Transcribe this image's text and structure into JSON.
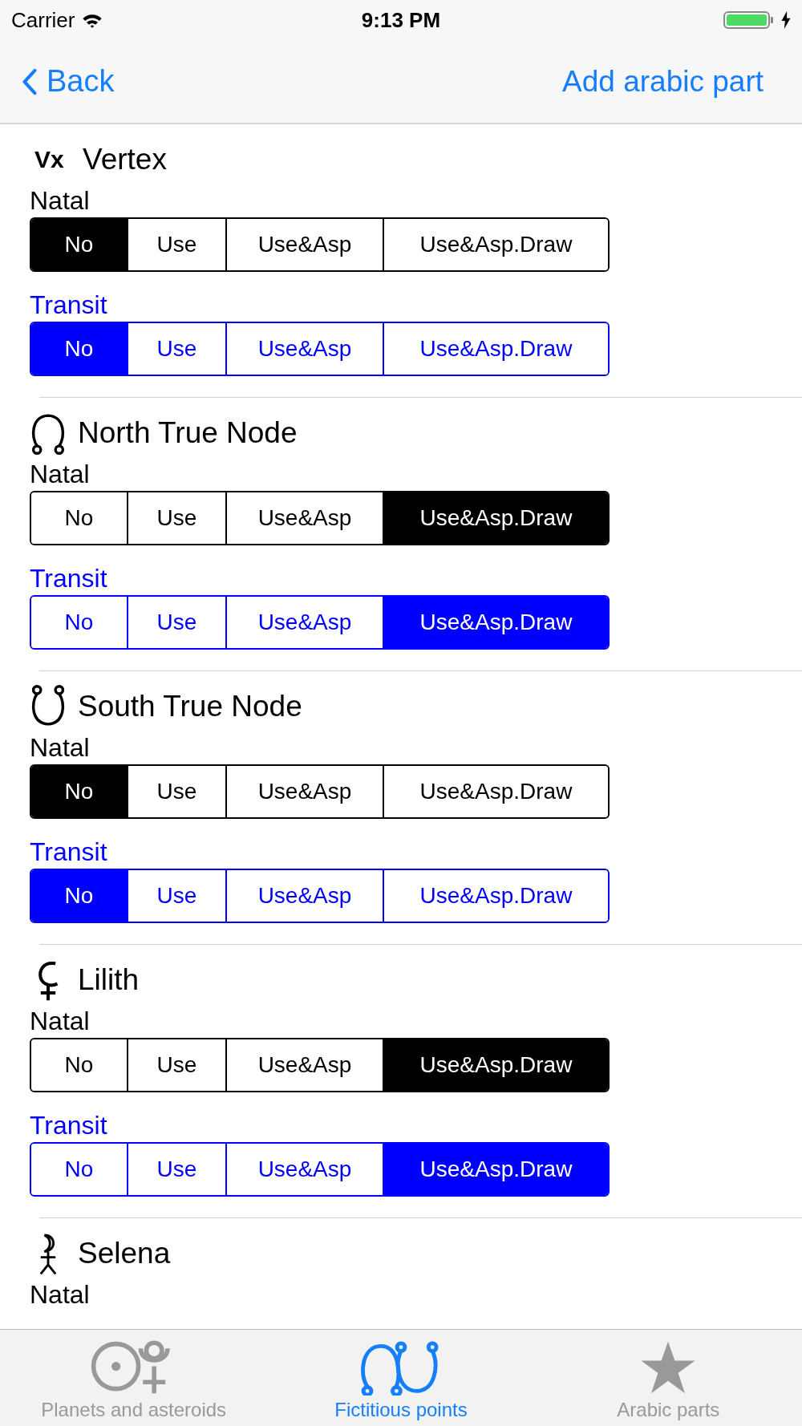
{
  "status_bar": {
    "carrier": "Carrier",
    "time": "9:13 PM"
  },
  "nav": {
    "back": "Back",
    "action": "Add arabic part"
  },
  "points": [
    {
      "name": "Vertex",
      "symbol": {
        "kind": "text",
        "text": "Vx"
      },
      "rows": [
        {
          "label": "Natal",
          "kind": "natal",
          "options": [
            {
              "label": "No",
              "selected": true
            },
            {
              "label": "Use",
              "selected": false
            },
            {
              "label": "Use&Asp",
              "selected": false
            },
            {
              "label": "Use&Asp.Draw",
              "selected": false
            }
          ]
        },
        {
          "label": "Transit",
          "kind": "transit",
          "options": [
            {
              "label": "No",
              "selected": true
            },
            {
              "label": "Use",
              "selected": false
            },
            {
              "label": "Use&Asp",
              "selected": false
            },
            {
              "label": "Use&Asp.Draw",
              "selected": false
            }
          ]
        }
      ]
    },
    {
      "name": "North True Node",
      "symbol": {
        "kind": "north-node"
      },
      "rows": [
        {
          "label": "Natal",
          "kind": "natal",
          "options": [
            {
              "label": "No",
              "selected": false
            },
            {
              "label": "Use",
              "selected": false
            },
            {
              "label": "Use&Asp",
              "selected": false
            },
            {
              "label": "Use&Asp.Draw",
              "selected": true
            }
          ]
        },
        {
          "label": "Transit",
          "kind": "transit",
          "options": [
            {
              "label": "No",
              "selected": false
            },
            {
              "label": "Use",
              "selected": false
            },
            {
              "label": "Use&Asp",
              "selected": false
            },
            {
              "label": "Use&Asp.Draw",
              "selected": true
            }
          ]
        }
      ]
    },
    {
      "name": "South True Node",
      "symbol": {
        "kind": "south-node"
      },
      "rows": [
        {
          "label": "Natal",
          "kind": "natal",
          "options": [
            {
              "label": "No",
              "selected": true
            },
            {
              "label": "Use",
              "selected": false
            },
            {
              "label": "Use&Asp",
              "selected": false
            },
            {
              "label": "Use&Asp.Draw",
              "selected": false
            }
          ]
        },
        {
          "label": "Transit",
          "kind": "transit",
          "options": [
            {
              "label": "No",
              "selected": true
            },
            {
              "label": "Use",
              "selected": false
            },
            {
              "label": "Use&Asp",
              "selected": false
            },
            {
              "label": "Use&Asp.Draw",
              "selected": false
            }
          ]
        }
      ]
    },
    {
      "name": "Lilith",
      "symbol": {
        "kind": "lilith"
      },
      "rows": [
        {
          "label": "Natal",
          "kind": "natal",
          "options": [
            {
              "label": "No",
              "selected": false
            },
            {
              "label": "Use",
              "selected": false
            },
            {
              "label": "Use&Asp",
              "selected": false
            },
            {
              "label": "Use&Asp.Draw",
              "selected": true
            }
          ]
        },
        {
          "label": "Transit",
          "kind": "transit",
          "options": [
            {
              "label": "No",
              "selected": false
            },
            {
              "label": "Use",
              "selected": false
            },
            {
              "label": "Use&Asp",
              "selected": false
            },
            {
              "label": "Use&Asp.Draw",
              "selected": true
            }
          ]
        }
      ]
    },
    {
      "name": "Selena",
      "symbol": {
        "kind": "selena"
      },
      "rows": [
        {
          "label": "Natal",
          "kind": "natal"
        }
      ]
    }
  ],
  "tab_bar": [
    {
      "label": "Planets and asteroids",
      "kind": "planets",
      "selected": false
    },
    {
      "label": "Fictitious points",
      "kind": "nodes",
      "selected": true
    },
    {
      "label": "Arabic parts",
      "kind": "star",
      "selected": false
    }
  ]
}
